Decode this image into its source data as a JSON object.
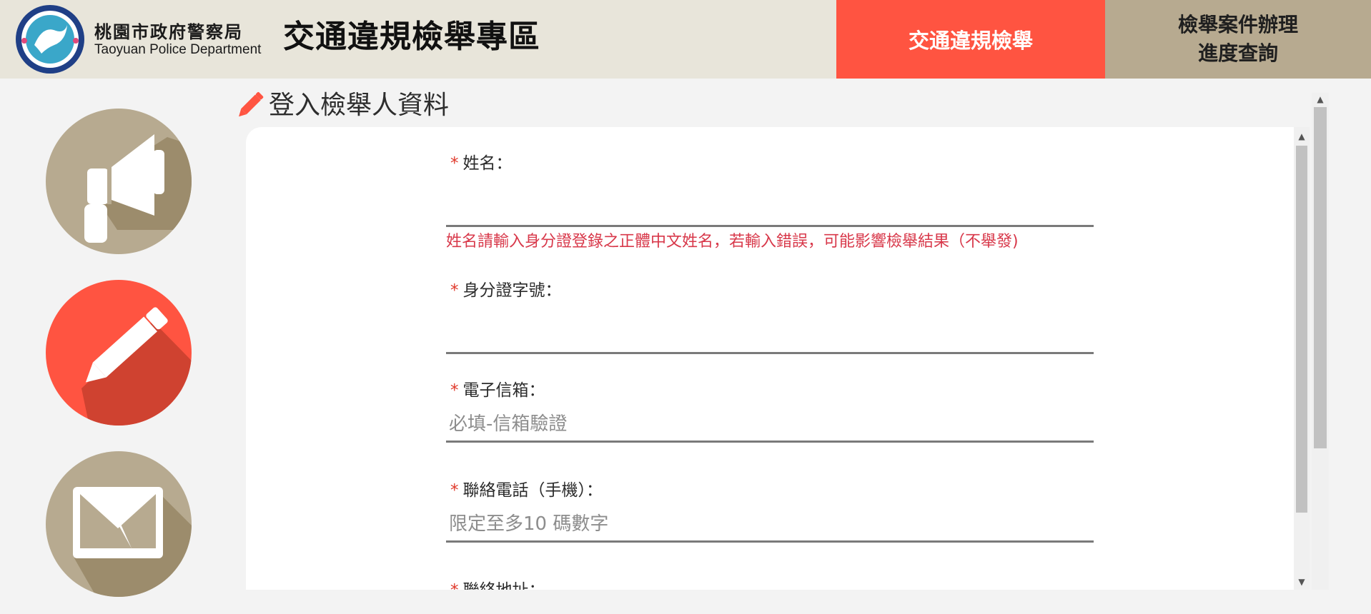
{
  "header": {
    "logo": {
      "name_cn": "桃園市政府警察局",
      "name_en": "Taoyuan Police Department"
    },
    "site_title": "交通違規檢舉專區",
    "nav": {
      "report_tab": "交通違規檢舉",
      "query_tab_line1": "檢舉案件辦理",
      "query_tab_line2": "進度查詢"
    }
  },
  "sidebar": {
    "icons": [
      {
        "icon": "megaphone-icon",
        "color": "#b7aa90"
      },
      {
        "icon": "pencil-icon",
        "color": "#ff5441"
      },
      {
        "icon": "mail-upload-icon",
        "color": "#b7aa90"
      }
    ]
  },
  "section": {
    "title": "登入檢舉人資料",
    "icon": "pencil-icon"
  },
  "form": {
    "required_mark": "*",
    "name": {
      "label": "姓名：",
      "value": "",
      "placeholder": ""
    },
    "name_hint": "姓名請輸入身分證登錄之正體中文姓名，若輸入錯誤，可能影響檢舉結果（不舉發)",
    "id_number": {
      "label": "身分證字號：",
      "value": "",
      "placeholder": ""
    },
    "email": {
      "label": "電子信箱：",
      "value": "",
      "placeholder": "必填-信箱驗證"
    },
    "phone": {
      "label": "聯絡電話（手機）：",
      "value": "",
      "placeholder": "限定至多10 碼數字"
    },
    "address": {
      "label": "聯絡地址："
    }
  },
  "colors": {
    "header_bg": "#e8e5da",
    "accent_red": "#ff5441",
    "accent_tan": "#b7aa90",
    "hint_red": "#d8384a"
  }
}
